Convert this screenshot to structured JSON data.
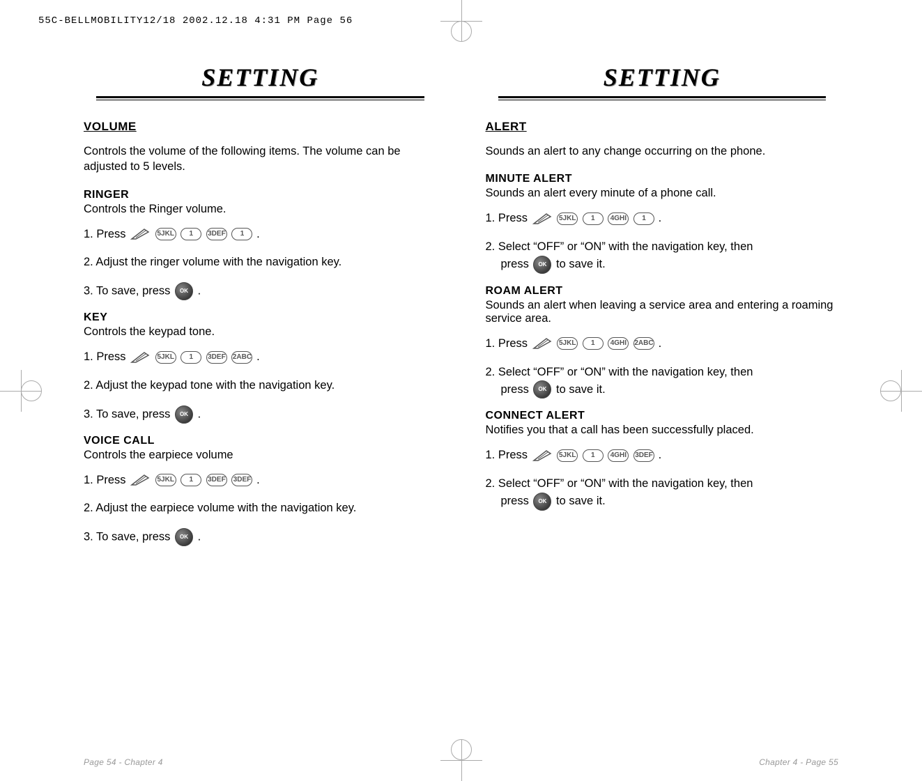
{
  "header": "55C-BELLMOBILITY12/18  2002.12.18  4:31 PM  Page 56",
  "left": {
    "title": "SETTING",
    "heading": "VOLUME",
    "intro": "Controls the volume of the following items. The volume can be adjusted to 5 levels.",
    "ringer": {
      "label": "RINGER",
      "desc": "Controls the Ringer volume.",
      "step1_prefix": "1. Press ",
      "step1_suffix": " .",
      "keys": [
        "5JKL",
        "1",
        "3DEF",
        "1"
      ],
      "step2": "2. Adjust the ringer volume with the navigation key.",
      "step3_prefix": "3. To save, press ",
      "step3_suffix": "  ."
    },
    "key": {
      "label": "KEY",
      "desc": "Controls the keypad tone.",
      "step1_prefix": "1. Press ",
      "step1_suffix": " .",
      "keys": [
        "5JKL",
        "1",
        "3DEF",
        "2ABC"
      ],
      "step2": "2. Adjust the keypad tone with the navigation key.",
      "step3_prefix": "3. To save, press ",
      "step3_suffix": "  ."
    },
    "voice": {
      "label": "VOICE CALL",
      "desc": "Controls the earpiece volume",
      "step1_prefix": "1. Press ",
      "step1_suffix": " .",
      "keys": [
        "5JKL",
        "1",
        "3DEF",
        "3DEF"
      ],
      "step2": "2. Adjust the earpiece volume with the navigation key.",
      "step3_prefix": "3. To save, press ",
      "step3_suffix": "  ."
    },
    "footer": "Page 54 - Chapter 4"
  },
  "right": {
    "title": "SETTING",
    "heading": "ALERT",
    "intro": "Sounds an alert to any change occurring on the phone.",
    "minute": {
      "label": "MINUTE ALERT",
      "desc": "Sounds an alert every minute of a phone call.",
      "step1_prefix": "1. Press ",
      "step1_suffix": " .",
      "keys": [
        "5JKL",
        "1",
        "4GHI",
        "1"
      ],
      "step2a": "2. Select “OFF” or “ON” with the navigation key, then",
      "step2b_prefix": "press ",
      "step2b_suffix": " to save it."
    },
    "roam": {
      "label": "ROAM ALERT",
      "desc": "Sounds an alert when leaving a service area and entering a roaming service area.",
      "step1_prefix": "1. Press ",
      "step1_suffix": " .",
      "keys": [
        "5JKL",
        "1",
        "4GHI",
        "2ABC"
      ],
      "step2a": "2. Select “OFF” or “ON” with the navigation key, then",
      "step2b_prefix": "press ",
      "step2b_suffix": " to save it."
    },
    "connect": {
      "label": "CONNECT ALERT",
      "desc": "Notifies you that a call has been successfully placed.",
      "step1_prefix": "1. Press ",
      "step1_suffix": " .",
      "keys": [
        "5JKL",
        "1",
        "4GHI",
        "3DEF"
      ],
      "step2a": "2. Select “OFF” or “ON” with the navigation key, then",
      "step2b_prefix": "press ",
      "step2b_suffix": " to save it."
    },
    "footer": "Chapter 4 - Page 55"
  }
}
